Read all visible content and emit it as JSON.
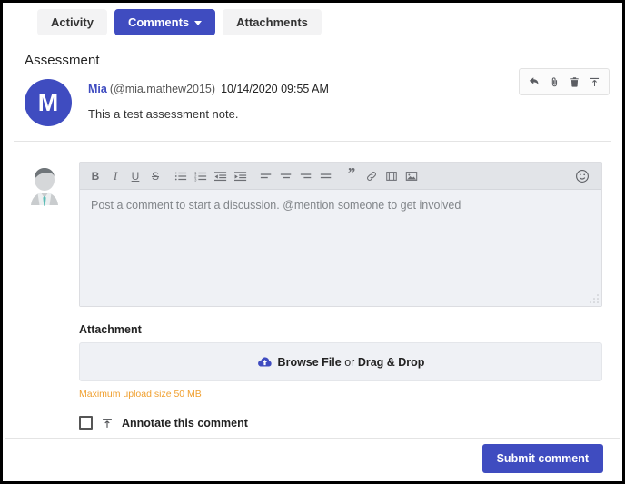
{
  "tabs": [
    {
      "label": "Activity",
      "active": false,
      "has_caret": false
    },
    {
      "label": "Comments",
      "active": true,
      "has_caret": true
    },
    {
      "label": "Attachments",
      "active": false,
      "has_caret": false
    }
  ],
  "section": {
    "title": "Assessment"
  },
  "note": {
    "avatar_initial": "M",
    "avatar_color": "#3f4cc0",
    "user": "Mia",
    "handle": "(@mia.mathew2015)",
    "timestamp": "10/14/2020 09:55 AM",
    "text": "This a test assessment note.",
    "actions": [
      {
        "name": "reply-icon",
        "title": "Reply"
      },
      {
        "name": "paperclip-icon",
        "title": "Attach"
      },
      {
        "name": "trash-icon",
        "title": "Delete"
      },
      {
        "name": "annotate-icon",
        "title": "Annotate"
      }
    ]
  },
  "editor": {
    "toolbar": [
      {
        "name": "bold-icon",
        "label": "B"
      },
      {
        "name": "italic-icon",
        "label": "I"
      },
      {
        "name": "underline-icon",
        "label": "U"
      },
      {
        "name": "strikethrough-icon",
        "label": "S"
      },
      {
        "name": "unordered-list-icon",
        "label": ""
      },
      {
        "name": "ordered-list-icon",
        "label": ""
      },
      {
        "name": "outdent-icon",
        "label": ""
      },
      {
        "name": "indent-icon",
        "label": ""
      },
      {
        "name": "align-left-icon",
        "label": ""
      },
      {
        "name": "align-center-icon",
        "label": ""
      },
      {
        "name": "align-right-icon",
        "label": ""
      },
      {
        "name": "align-justify-icon",
        "label": ""
      },
      {
        "name": "blockquote-icon",
        "label": "”"
      },
      {
        "name": "link-icon",
        "label": ""
      },
      {
        "name": "video-icon",
        "label": ""
      },
      {
        "name": "image-icon",
        "label": ""
      },
      {
        "name": "emoji-icon",
        "label": ""
      }
    ],
    "placeholder": "Post a comment to start a discussion. @mention someone to get involved",
    "value": ""
  },
  "attachment": {
    "label": "Attachment",
    "browse_label": "Browse File",
    "or_label": "or",
    "drag_label": "Drag & Drop",
    "max_size_note": "Maximum upload size 50 MB",
    "cloud_color": "#3f4cc0"
  },
  "annotate": {
    "label": "Annotate this comment",
    "checked": false
  },
  "footer": {
    "submit_label": "Submit comment",
    "submit_color": "#3f4cc0"
  }
}
